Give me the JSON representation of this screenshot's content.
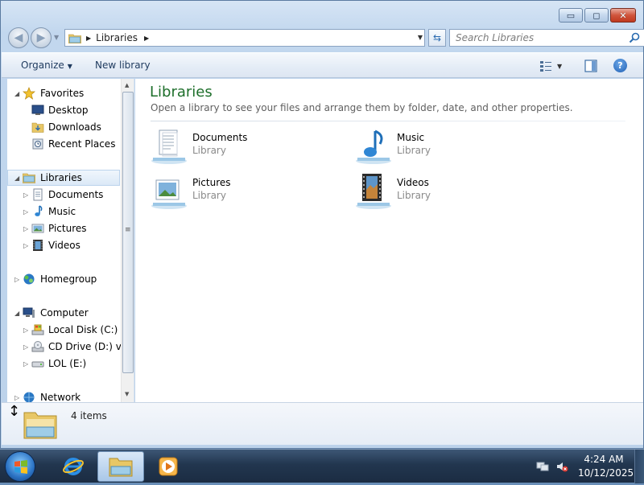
{
  "window": {
    "caption_buttons": {
      "minimize": "▭",
      "maximize": "◻",
      "close": "✕"
    }
  },
  "address_bar": {
    "path": "Libraries"
  },
  "search": {
    "placeholder": "Search Libraries"
  },
  "toolbar": {
    "organize_label": "Organize",
    "new_library_label": "New library",
    "help_label": "?"
  },
  "nav_pane": {
    "favorites": {
      "label": "Favorites",
      "items": [
        {
          "label": "Desktop",
          "icon": "desktop-icon"
        },
        {
          "label": "Downloads",
          "icon": "downloads-folder-icon"
        },
        {
          "label": "Recent Places",
          "icon": "recent-places-icon"
        }
      ]
    },
    "libraries": {
      "label": "Libraries",
      "items": [
        {
          "label": "Documents",
          "icon": "documents-icon"
        },
        {
          "label": "Music",
          "icon": "music-icon"
        },
        {
          "label": "Pictures",
          "icon": "pictures-icon"
        },
        {
          "label": "Videos",
          "icon": "videos-icon"
        }
      ]
    },
    "homegroup": {
      "label": "Homegroup"
    },
    "computer": {
      "label": "Computer",
      "items": [
        {
          "label": "Local Disk (C:)",
          "icon": "local-disk-icon"
        },
        {
          "label": "CD Drive (D:) virt",
          "icon": "cd-drive-icon"
        },
        {
          "label": "LOL (E:)",
          "icon": "removable-drive-icon"
        }
      ]
    },
    "network": {
      "label": "Network"
    }
  },
  "content": {
    "title": "Libraries",
    "subtitle": "Open a library to see your files and arrange them by folder, date, and other properties.",
    "libraries": [
      {
        "name": "Documents",
        "type": "Library",
        "icon": "documents-library-icon"
      },
      {
        "name": "Music",
        "type": "Library",
        "icon": "music-library-icon"
      },
      {
        "name": "Pictures",
        "type": "Library",
        "icon": "pictures-library-icon"
      },
      {
        "name": "Videos",
        "type": "Library",
        "icon": "videos-library-icon"
      }
    ]
  },
  "details_pane": {
    "item_count": "4 items"
  },
  "taskbar": {
    "apps": [
      "internet-explorer-icon",
      "windows-explorer-icon",
      "windows-media-player-icon"
    ],
    "clock_time": "4:24 AM",
    "clock_date": "10/12/2025"
  },
  "colors": {
    "title_green": "#1e6f2b",
    "selection": "#dbe9f7",
    "taskbar": "#22364f"
  }
}
